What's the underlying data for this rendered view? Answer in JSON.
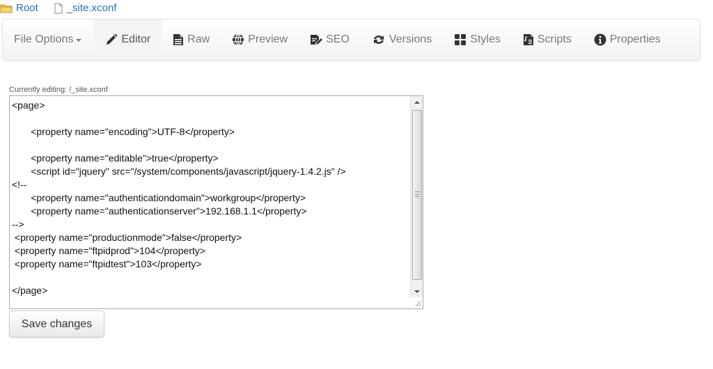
{
  "breadcrumb": {
    "items": [
      {
        "label": "Root",
        "icon": "folder-icon"
      },
      {
        "label": "_site.xconf",
        "icon": "file-icon"
      }
    ]
  },
  "navbar": {
    "file_options": "File Options",
    "items": [
      {
        "label": "Editor",
        "icon": "pencil-icon",
        "active": true
      },
      {
        "label": "Raw",
        "icon": "document-icon"
      },
      {
        "label": "Preview",
        "icon": "globe-icon"
      },
      {
        "label": "SEO",
        "icon": "edit-document-icon"
      },
      {
        "label": "Versions",
        "icon": "refresh-icon"
      },
      {
        "label": "Styles",
        "icon": "grid-icon"
      },
      {
        "label": "Scripts",
        "icon": "script-file-icon"
      },
      {
        "label": "Properties",
        "icon": "info-icon"
      }
    ]
  },
  "editor": {
    "label": "Currently editing: /_site.xconf",
    "lines": [
      "<page>",
      "",
      "       <property name=\"encoding\">UTF-8</property>",
      "",
      "       <property name=\"editable\">true</property>",
      "       <script id=\"jquery\" src=\"/system/components/javascript/jquery-1.4.2.js\" />",
      "<!--",
      "       <property name=\"authenticationdomain\">workgroup</property>",
      "       <property name=\"authenticationserver\">192.168.1.1</property>",
      "-->",
      " <property name=\"productionmode\">false</property>",
      " <property name=\"ftpidprod\">104</property>",
      " <property name=\"ftpidtest\">103</property>",
      "",
      "</page>"
    ]
  },
  "actions": {
    "save_label": "Save changes"
  },
  "colors": {
    "link": "#2a6fb5",
    "nav_text": "#777777",
    "icon": "#333333"
  }
}
